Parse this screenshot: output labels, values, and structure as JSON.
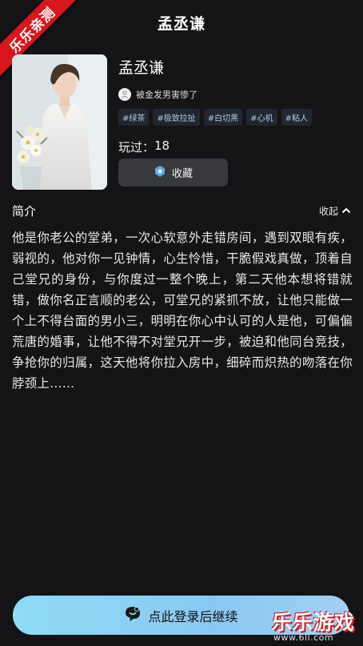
{
  "header": {
    "title": "孟丞谦"
  },
  "ribbon": {
    "label": "乐乐亲测"
  },
  "book": {
    "name": "孟丞谦",
    "author": "被金发男害惨了",
    "tags": [
      "#绿茶",
      "#极致拉扯",
      "#白切黑",
      "#心机",
      "#粘人"
    ],
    "plays_label": "玩过：",
    "plays_count": "18",
    "favorite_label": "收藏"
  },
  "intro": {
    "title": "简介",
    "collapse_label": "收起",
    "text": "他是你老公的堂弟，一次心软意外走错房间，遇到双眼有疾，弱视的，他对你一见钟情，心生怜惜，干脆假戏真做，顶着自己堂兄的身份，与你度过一整个晚上，第二天他本想将错就错，做你名正言顺的老公，可堂兄的紧抓不放，让他只能做一个上不得台面的男小三，明明在你心中认可的人是他，可偏偏荒唐的婚事，让他不得不对堂兄开一步，被迫和他同台竞技，争抢你的归属，这天他将你拉入房中，细碎而炽热的吻落在你脖颈上……"
  },
  "login": {
    "label": "点此登录后继续"
  },
  "watermark": {
    "logo": "乐乐游戏",
    "url": "www.6ll.com"
  },
  "colors": {
    "background": "#141416",
    "tag_text": "#a9c9ee",
    "login_gradient": "#8fdcf5",
    "ribbon": "#d8171c"
  },
  "icons": {
    "author": "user-avatar-icon",
    "favorite": "star-badge-icon",
    "collapse": "chevron-up-icon",
    "login": "chat-bubble-icon"
  }
}
